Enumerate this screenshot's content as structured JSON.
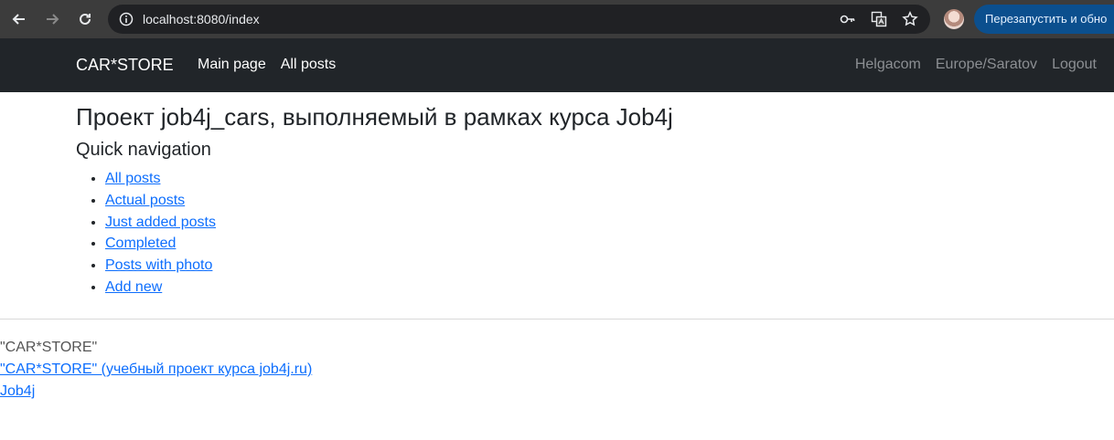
{
  "browser": {
    "url": "localhost:8080/index",
    "relaunch_label": "Перезапустить и обно",
    "icons": [
      "back-arrow-icon",
      "forward-arrow-icon",
      "reload-icon",
      "info-icon",
      "key-icon",
      "translate-icon",
      "star-icon"
    ]
  },
  "navbar": {
    "brand": "CAR*STORE",
    "links": [
      "Main page",
      "All posts"
    ],
    "right": [
      "Helgacom",
      "Europe/Saratov",
      "Logout"
    ]
  },
  "page": {
    "title": "Проект job4j_cars, выполняемый в рамках курса Job4j",
    "subtitle": "Quick navigation",
    "quick_links": [
      "All posts",
      "Actual posts",
      "Just added posts",
      "Completed",
      "Posts with photo",
      "Add new"
    ]
  },
  "footer": {
    "name": "\"CAR*STORE\"",
    "project_link": "\"CAR*STORE\" (учебный проект курса job4j.ru)",
    "job4j_link": "Job4j"
  },
  "colors": {
    "navbar_bg": "#212529",
    "link": "#0d6efd",
    "chrome_bg": "#3c3c3c",
    "relaunch_bg": "#0b4f8e"
  }
}
